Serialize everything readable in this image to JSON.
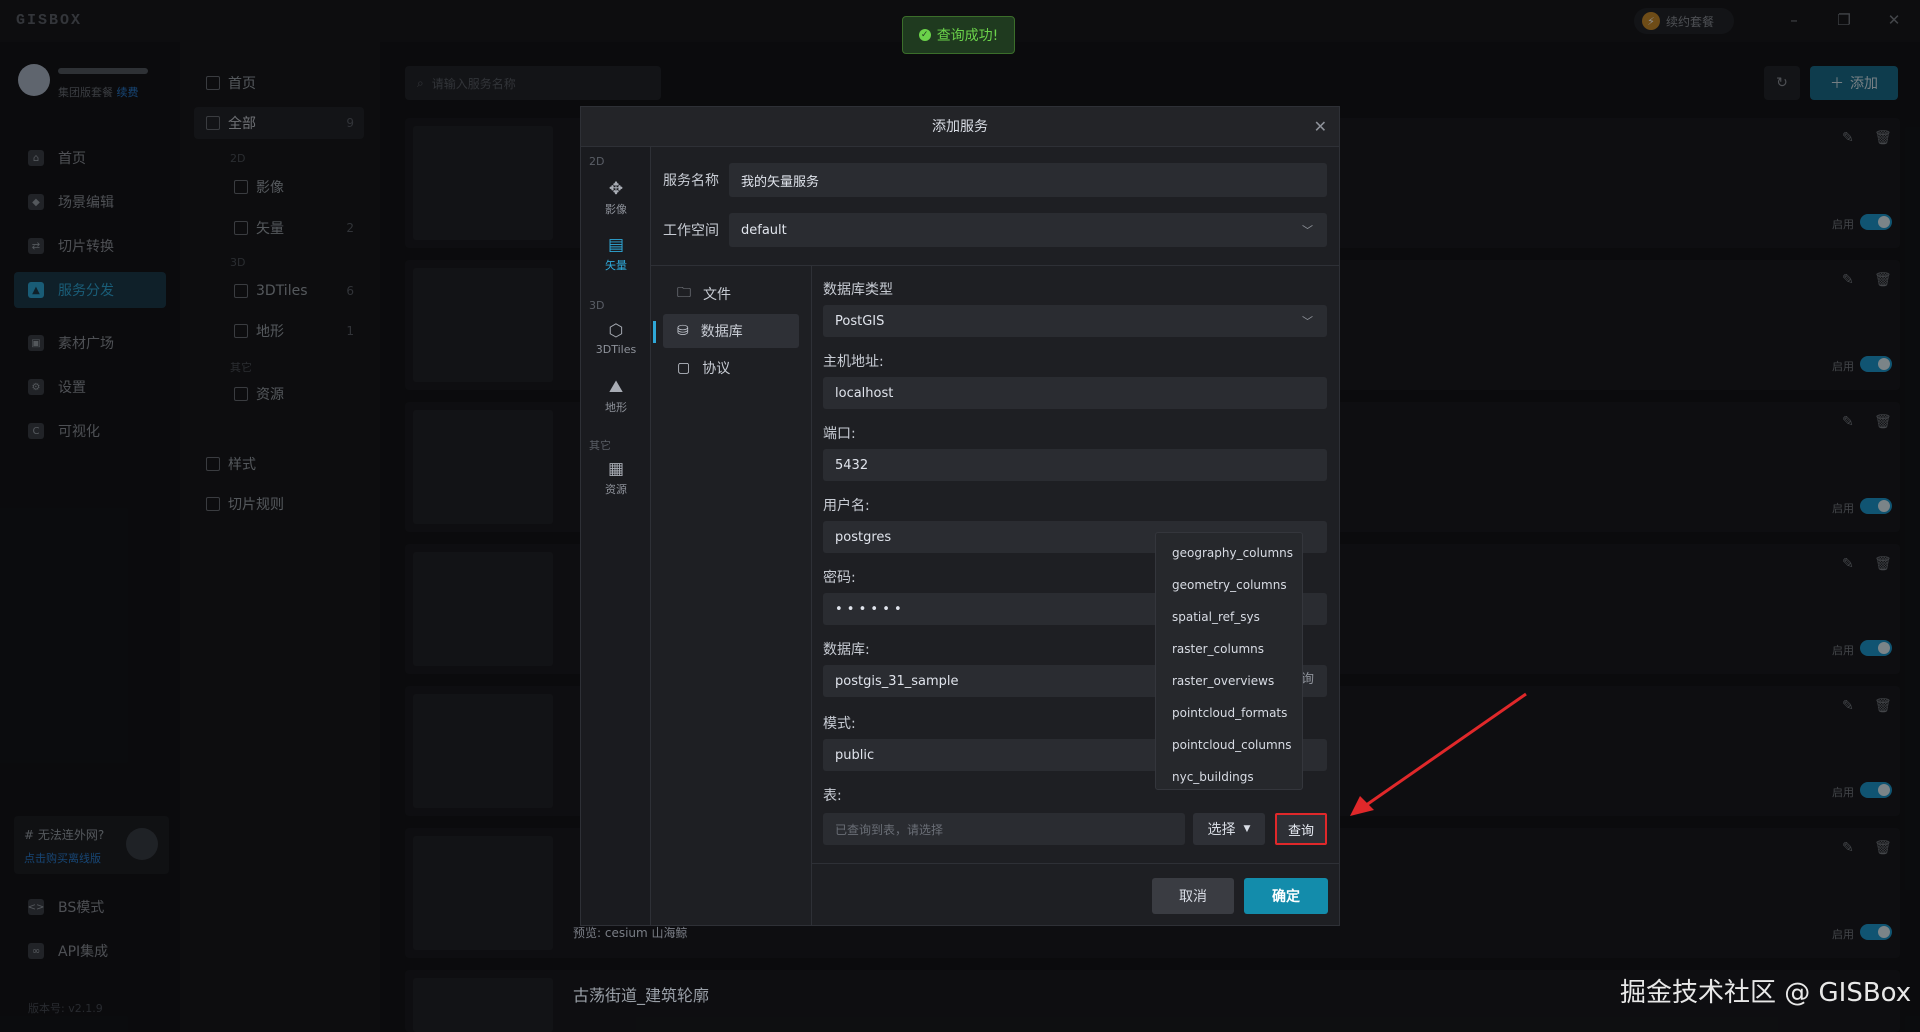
{
  "app": {
    "logo": "GISBOX",
    "renew": "续约套餐"
  },
  "toast": {
    "text": "查询成功!"
  },
  "user": {
    "org": "集团版套餐",
    "renew_link": "续费"
  },
  "nav": [
    {
      "label": "首页",
      "icon": "home-icon"
    },
    {
      "label": "场景编辑",
      "icon": "cube-icon"
    },
    {
      "label": "切片转换",
      "icon": "swap-icon"
    },
    {
      "label": "服务分发",
      "icon": "upload-icon",
      "active": true
    },
    {
      "label": "素材广场",
      "icon": "image-icon"
    },
    {
      "label": "设置",
      "icon": "gear-icon"
    },
    {
      "label": "可视化",
      "icon": "chart-icon"
    }
  ],
  "net": {
    "title": "# 无法连外网?",
    "link": "点击购买离线版"
  },
  "nav_bottom": [
    {
      "label": "BS模式",
      "icon": "code-icon"
    },
    {
      "label": "API集成",
      "icon": "link-icon"
    }
  ],
  "version": "版本号: v2.1.9",
  "tree": {
    "home": "首页",
    "all": "全部",
    "all_count": "9",
    "sec_2d": "2D",
    "imagery": "影像",
    "vector": "矢量",
    "vector_count": "2",
    "sec_3d": "3D",
    "tiles3d": "3DTiles",
    "tiles3d_count": "6",
    "terrain": "地形",
    "terrain_count": "1",
    "sec_other": "其它",
    "resource": "资源",
    "style": "样式",
    "rules": "切片规则"
  },
  "search": {
    "placeholder": "请输入服务名称"
  },
  "toolbar": {
    "add": "添加"
  },
  "cards": {
    "enable": "启用"
  },
  "preview": "预览: cesium  山海鲸",
  "last_card_title": "古荡街道_建筑轮廓",
  "modal": {
    "title": "添加服务",
    "left": {
      "sec_2d": "2D",
      "imagery": "影像",
      "vector": "矢量",
      "sec_3d": "3D",
      "tiles3d": "3DTiles",
      "terrain": "地形",
      "sec_other": "其它",
      "resource": "资源"
    },
    "name_label": "服务名称",
    "name_value": "我的矢量服务",
    "ws_label": "工作空间",
    "ws_value": "default",
    "tabs": [
      "文件",
      "数据库",
      "协议"
    ],
    "db_type_label": "数据库类型",
    "db_type": "PostGIS",
    "host_label": "主机地址:",
    "host": "localhost",
    "port_label": "端口:",
    "port": "5432",
    "user_label": "用户名:",
    "username": "postgres",
    "pwd_label": "密码:",
    "pwd": "• • • • • •",
    "db_label": "数据库:",
    "db": "postgis_31_sample",
    "schema_label": "模式:",
    "schema": "public",
    "table_label": "表:",
    "table_placeholder": "已查询到表，请选择",
    "select": "选择",
    "query": "查询",
    "cancel": "取消",
    "ok": "确定"
  },
  "dropdown": [
    "geography_columns",
    "geometry_columns",
    "spatial_ref_sys",
    "raster_columns",
    "raster_overviews",
    "pointcloud_formats",
    "pointcloud_columns",
    "nyc_buildings"
  ],
  "watermark": "掘金技术社区 @ GISBox",
  "colors": {
    "accent": "#1e9ad0",
    "primary_button": "#138cab",
    "highlight_border": "#e0282a",
    "success": "#6bd24a"
  }
}
